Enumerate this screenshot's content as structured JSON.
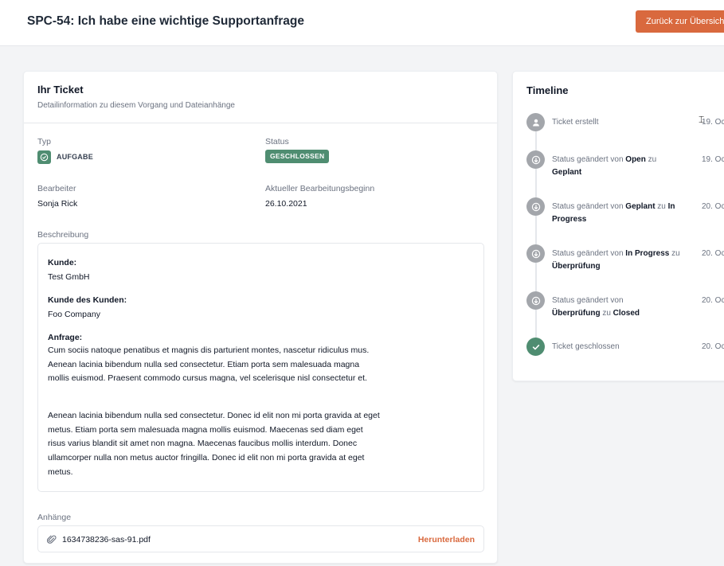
{
  "header": {
    "title": "SPC-54: Ich habe eine wichtige Supportanfrage",
    "back_label": "Zurück zur Übersicht"
  },
  "ticket": {
    "title": "Ihr Ticket",
    "subtitle": "Detailinformation zu diesem Vorgang und Dateianhänge",
    "type_label": "Typ",
    "type_value": "AUFGABE",
    "status_label": "Status",
    "status_value": "GESCHLOSSEN",
    "assignee_label": "Bearbeiter",
    "assignee_value": "Sonja Rick",
    "start_label": "Aktueller Bearbeitungsbeginn",
    "start_value": "26.10.2021",
    "description_label": "Beschreibung",
    "description": {
      "customer_label": "Kunde:",
      "customer_value": "Test GmbH",
      "end_customer_label": "Kunde des Kunden:",
      "end_customer_value": "Foo Company",
      "request_label": "Anfrage:",
      "paragraph1": "Cum sociis natoque penatibus et magnis dis parturient montes, nascetur ridiculus mus. Aenean lacinia bibendum nulla sed consectetur. Etiam porta sem malesuada magna mollis euismod. Praesent commodo cursus magna, vel scelerisque nisl consectetur et.",
      "paragraph2": "Aenean lacinia bibendum nulla sed consectetur. Donec id elit non mi porta gravida at eget metus. Etiam porta sem malesuada magna mollis euismod. Maecenas sed diam eget risus varius blandit sit amet non magna. Maecenas faucibus mollis interdum. Donec ullamcorper nulla non metus auctor fringilla. Donec id elit non mi porta gravida at eget metus."
    },
    "attachments_label": "Anhänge",
    "attachment_file": "1634738236-sas-91.pdf",
    "download_label": "Herunterladen"
  },
  "timeline": {
    "title": "Timeline",
    "events": [
      {
        "pre": "Ticket erstellt",
        "date": "19. Oc"
      },
      {
        "pre": "Status geändert von ",
        "from": "Open",
        "mid": " zu ",
        "to": "Geplant",
        "date": "19. Oc"
      },
      {
        "pre": "Status geändert von ",
        "from": "Geplant",
        "mid": " zu ",
        "to": "In Progress",
        "date": "20. Oc"
      },
      {
        "pre": "Status geändert von ",
        "from": "In Progress",
        "mid": " zu ",
        "to": "Überprüfung",
        "date": "20. Oc"
      },
      {
        "pre": "Status geändert von ",
        "from": "Überprüfung",
        "mid": " zu ",
        "to": "Closed",
        "date": "20. Oc"
      },
      {
        "pre": "Ticket geschlossen",
        "date": "20. Oc"
      }
    ]
  },
  "colors": {
    "accent": "#d9693e",
    "success": "#4f8d71",
    "timeline_dot": "#a3a6ab"
  }
}
